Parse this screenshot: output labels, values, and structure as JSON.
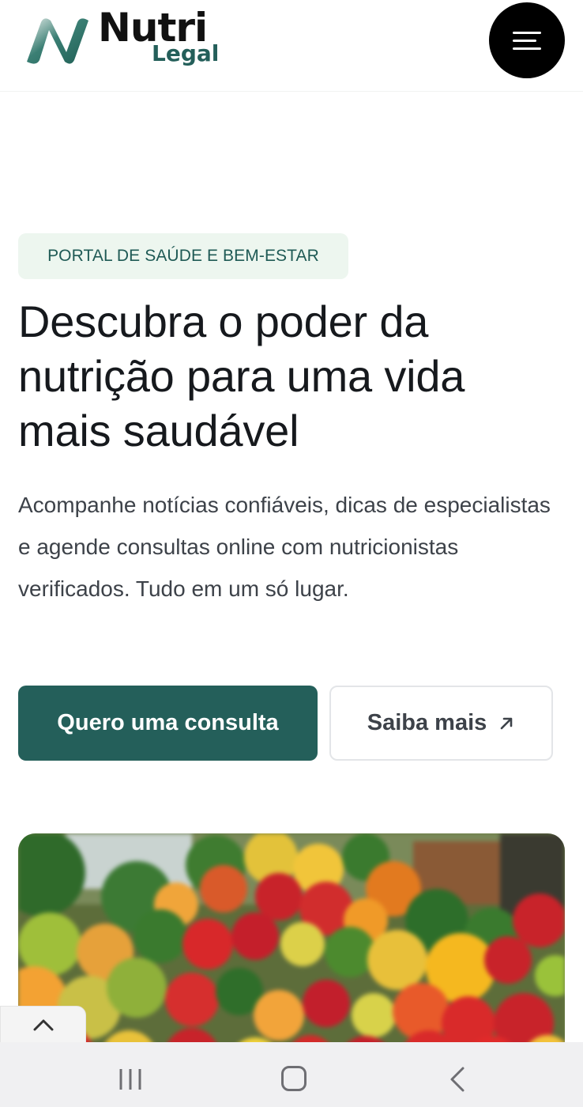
{
  "header": {
    "logo": {
      "word": "Nutri",
      "sub": "Legal"
    },
    "menu_icon": "hamburger-menu-icon"
  },
  "hero": {
    "badge": "PORTAL DE SAÚDE E BEM-ESTAR",
    "title": "Descubra o poder da nutrição para uma vida mais saudável",
    "description": "Acompanhe notícias confiáveis, dicas de especialistas e agende consultas online com nutricionistas verificados. Tudo em um só lugar.",
    "primary_button": "Quero uma consulta",
    "secondary_button": "Saiba mais",
    "secondary_icon": "arrow-up-right-icon",
    "image_subject": "fresh fruits and vegetables"
  },
  "colors": {
    "brand": "#245f5a",
    "badge_bg": "#edf6ef",
    "text": "#16191d",
    "muted": "#3d4249"
  },
  "system_nav": {
    "icons": [
      "recents-icon",
      "home-icon",
      "back-icon"
    ]
  },
  "scroll_top_icon": "chevron-up-icon"
}
